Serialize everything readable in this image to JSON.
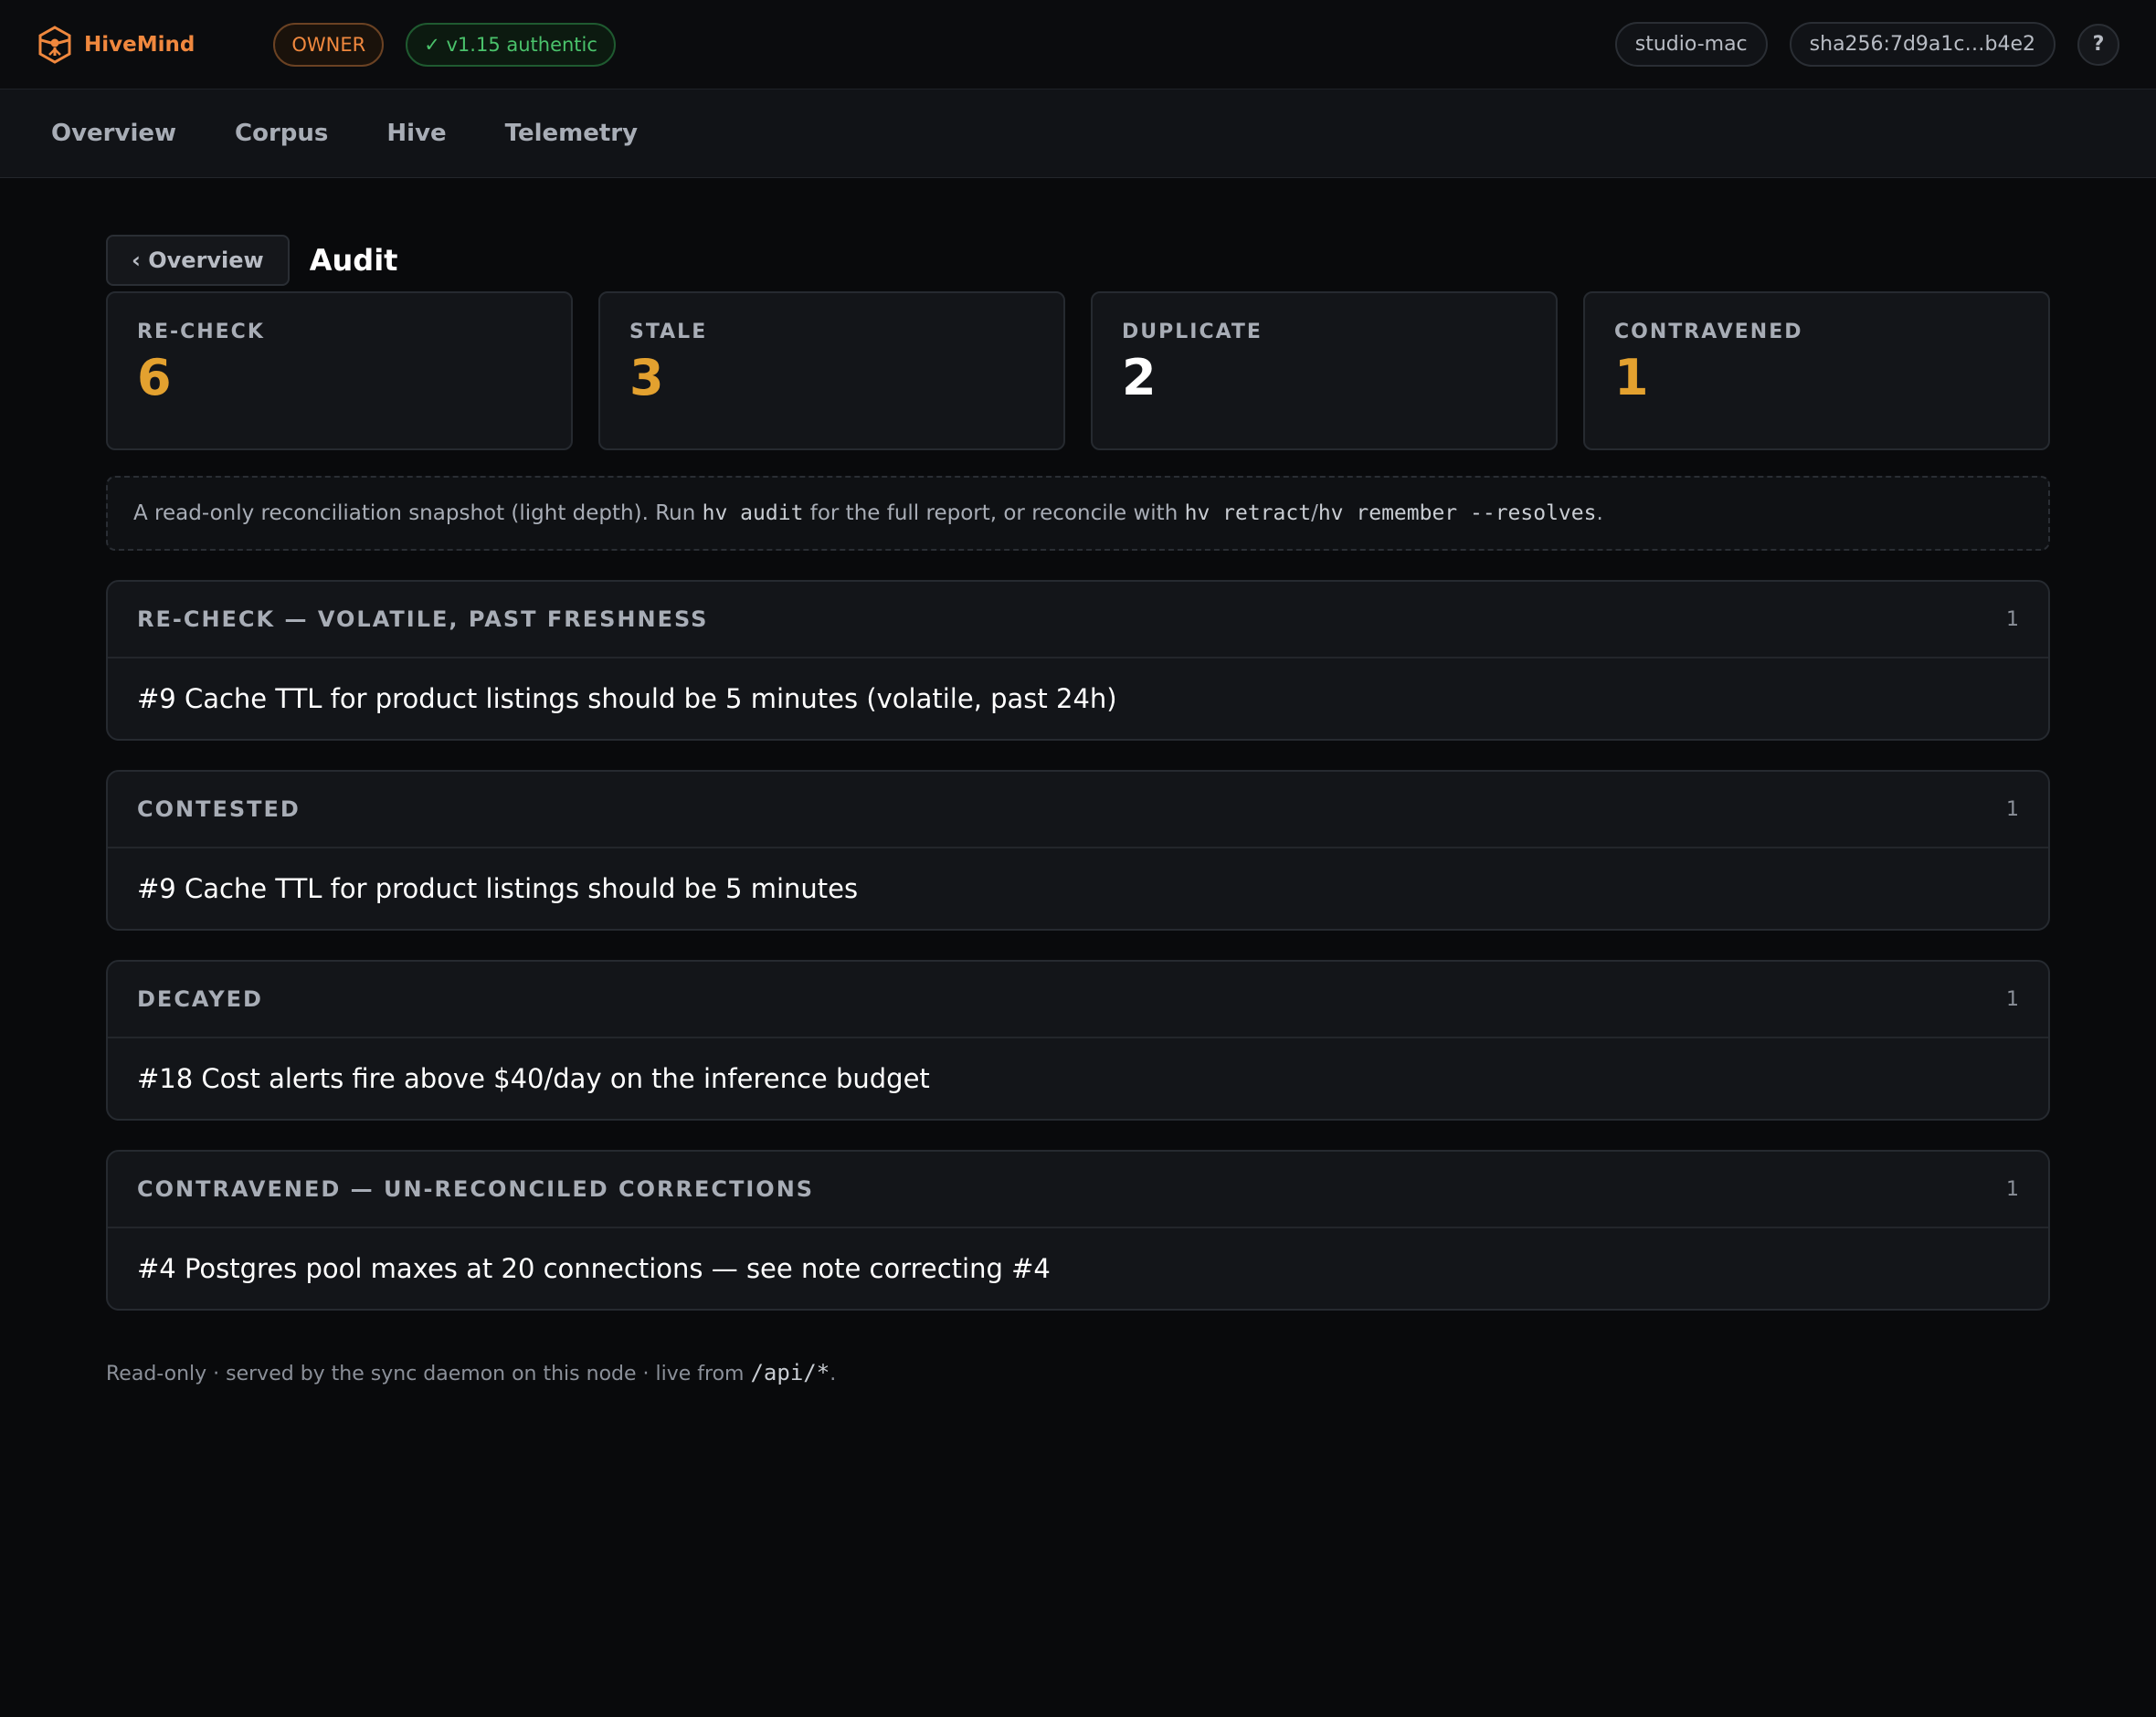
{
  "header": {
    "brand": "HiveMind",
    "role_badge": "OWNER",
    "auth_badge": "✓ v1.15 authentic",
    "host": "studio-mac",
    "hash": "sha256:7d9a1c…b4e2",
    "help": "?",
    "icons": {
      "logo": "hive-logo-icon"
    }
  },
  "nav": {
    "tabs": [
      "Overview",
      "Corpus",
      "Hive",
      "Telemetry"
    ]
  },
  "page": {
    "back_label": "‹ Overview",
    "title": "Audit"
  },
  "stats": [
    {
      "label": "RE-CHECK",
      "value": "6",
      "color": "#e3a12f"
    },
    {
      "label": "STALE",
      "value": "3",
      "color": "#e3a12f"
    },
    {
      "label": "DUPLICATE",
      "value": "2",
      "color": "#ffffff"
    },
    {
      "label": "CONTRAVENED",
      "value": "1",
      "color": "#e3a12f"
    }
  ],
  "note": {
    "text_1": "A read-only reconciliation snapshot (light depth). Run",
    "cmd_1": "hv audit",
    "text_2": "for the full report, or reconcile with",
    "cmd_2": "hv retract",
    "sep": "/",
    "cmd_3": "hv remember --resolves",
    "text_3": "."
  },
  "sections": [
    {
      "title": "RE-CHECK — VOLATILE, PAST FRESHNESS",
      "count": "1",
      "item": "#9 Cache TTL for product listings should be 5 minutes (volatile, past 24h)"
    },
    {
      "title": "CONTESTED",
      "count": "1",
      "item": "#9 Cache TTL for product listings should be 5 minutes"
    },
    {
      "title": "DECAYED",
      "count": "1",
      "item": "#18 Cost alerts fire above $40/day on the inference budget"
    },
    {
      "title": "CONTRAVENED — UN-RECONCILED CORRECTIONS",
      "count": "1",
      "item": "#4 Postgres pool maxes at 20 connections — see note correcting #4"
    }
  ],
  "footer": {
    "text": "Read-only · served by the sync daemon on this node · live from",
    "path": "/api/*",
    "end": "."
  },
  "colors": {
    "accent": "#f0883e",
    "success": "#4ac26b",
    "warning": "#e3a12f"
  }
}
